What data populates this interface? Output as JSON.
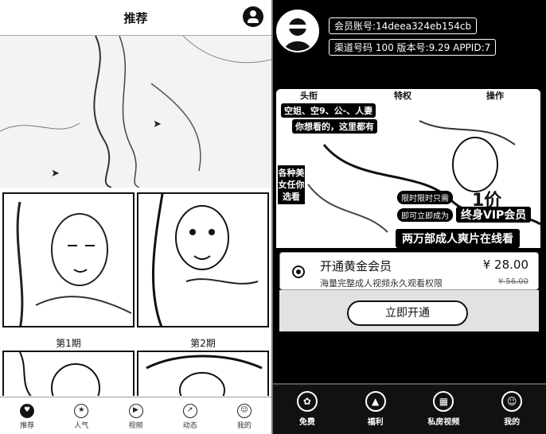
{
  "left": {
    "header": {
      "title": "推荐"
    },
    "issues": [
      "第1期",
      "第2期"
    ],
    "tabs": [
      {
        "label": "推荐",
        "icon": "heart-icon",
        "glyph": "♥",
        "active": true
      },
      {
        "label": "人气",
        "icon": "star-icon",
        "glyph": "★",
        "active": false
      },
      {
        "label": "视频",
        "icon": "play-icon",
        "glyph": "▶",
        "active": false
      },
      {
        "label": "动态",
        "icon": "trend-icon",
        "glyph": "↗",
        "active": false
      },
      {
        "label": "我的",
        "icon": "user-icon",
        "glyph": "☺",
        "active": false
      }
    ]
  },
  "right": {
    "account": {
      "member_line": "会员账号:14deea324eb154cb",
      "channel_line": "渠道号码 100 版本号:9.29 APPID:7"
    },
    "banner": {
      "tabs": [
        "头衔",
        "特权",
        "操作"
      ],
      "caption_top": "空姐、空9、公-、人妻",
      "caption_mid": "你想看的，这里都有",
      "side_text": "各种美女任你选看",
      "number": "1价",
      "pill_1": "限时限时只需",
      "pill_2": "即可立即成为",
      "vip": "终身VIP会员",
      "bottom": "两万部成人爽片在线看"
    },
    "offer": {
      "title": "开通黄金会员",
      "price": "¥ 28.00",
      "desc": "海量完整成人视频永久观看权限",
      "old_price": "¥ 56.00"
    },
    "pay_button": "立即开通",
    "tabs": [
      {
        "label": "免费",
        "icon": "gift-icon",
        "glyph": "✿"
      },
      {
        "label": "福利",
        "icon": "mountain-icon",
        "glyph": "▲"
      },
      {
        "label": "私房视频",
        "icon": "film-icon",
        "glyph": "▦"
      },
      {
        "label": "我的",
        "icon": "user-icon",
        "glyph": "☺"
      }
    ]
  }
}
